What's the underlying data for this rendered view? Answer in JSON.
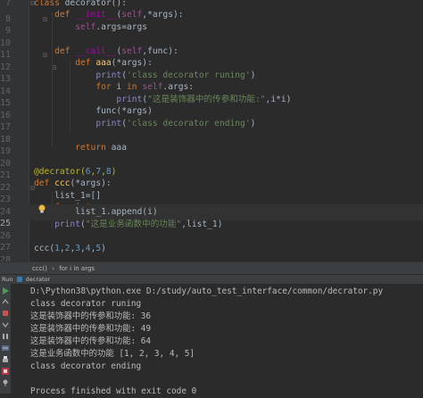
{
  "editor": {
    "lines": [
      {
        "number": "7",
        "text": "class decorator():"
      },
      {
        "number": "8",
        "text": "    def __init__(self,*args):"
      },
      {
        "number": "9",
        "text": "        self.args=args"
      },
      {
        "number": "10",
        "text": ""
      },
      {
        "number": "11",
        "text": "    def __call__(self,func):"
      },
      {
        "number": "12",
        "text": "        def aaa(*args):"
      },
      {
        "number": "13",
        "text": "            print('class decorator runing')"
      },
      {
        "number": "14",
        "text": "            for i in self.args:"
      },
      {
        "number": "15",
        "text": "                print(\"这是装饰器中的传参和功能:\",i*i)"
      },
      {
        "number": "16",
        "text": "            func(*args)"
      },
      {
        "number": "17",
        "text": "            print('class decorator ending')"
      },
      {
        "number": "18",
        "text": ""
      },
      {
        "number": "19",
        "text": "        return aaa"
      },
      {
        "number": "20",
        "text": ""
      },
      {
        "number": "21",
        "text": "@decrator(6,7,8)"
      },
      {
        "number": "22",
        "text": "def ccc(*args):"
      },
      {
        "number": "23",
        "text": "    list_1=[]"
      },
      {
        "number": "24",
        "text": "    for i in args:"
      },
      {
        "number": "25",
        "text": "        list_1.append(i)"
      },
      {
        "number": "26",
        "text": "    print(\"这是业务函数中的功能\",list_1)"
      },
      {
        "number": "27",
        "text": ""
      },
      {
        "number": "28",
        "text": "ccc(1,2,3,4,5)"
      }
    ],
    "current_line": "25"
  },
  "breadcrumb": {
    "items": [
      "ccc()",
      "for i in args"
    ],
    "separator": "›"
  },
  "run_panel": {
    "tab_prefix": "Run",
    "tab_label": "decrator"
  },
  "console": {
    "lines": [
      "D:\\Python38\\python.exe D:/study/auto_test_interface/common/decrator.py",
      "class decorator runing",
      "这是装饰器中的传参和功能: 36",
      "这是装饰器中的传参和功能: 49",
      "这是装饰器中的传参和功能: 64",
      "这是业务函数中的功能 [1, 2, 3, 4, 5]",
      "class decorator ending",
      "",
      "Process finished with exit code 0"
    ]
  },
  "colors": {
    "editor_bg": "#2b2b2b",
    "keyword": "#cc7832",
    "function_name": "#ffc66d",
    "string": "#6a8759",
    "number": "#6897bb",
    "decorator": "#bbb529",
    "self": "#94558d",
    "run_icon": "#499c54",
    "stop_icon": "#c75450"
  }
}
